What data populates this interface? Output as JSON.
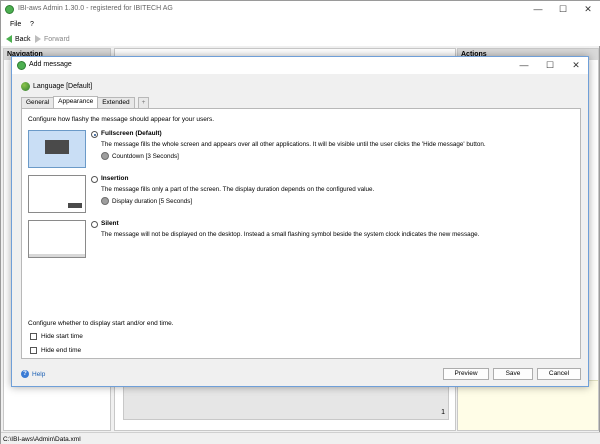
{
  "main": {
    "title": "IBI-aws Admin 1.30.0 - registered for IBITECH AG",
    "menu": [
      "File",
      "?"
    ],
    "back": "Back",
    "forward": "Forward",
    "nav_header": "Navigation",
    "actions_header": "Actions",
    "page_number": "1",
    "status_path": "C:\\IBI-aws\\Admin\\Data.xml"
  },
  "dialog": {
    "title": "Add message",
    "language": "Language [Default]",
    "tabs": [
      "General",
      "Appearance",
      "Extended",
      "+"
    ],
    "intro": "Configure how flashy the message should appear for your users.",
    "modes": [
      {
        "title": "Fullscreen (Default)",
        "desc": "The message fills the whole screen and appears over all other applications. It will be visible until the user clicks  the 'Hide message' button.",
        "option": "Countdown [3 Seconds]",
        "selected": true
      },
      {
        "title": "Insertion",
        "desc": "The message fills only a part of the screen. The display duration depends on the configured value.",
        "option": "Display duration [5 Seconds]",
        "selected": false
      },
      {
        "title": "Silent",
        "desc": "The message will not be displayed on the desktop. Instead a small flashing symbol beside the system clock indicates the new message.",
        "option": "",
        "selected": false
      }
    ],
    "time_config": "Configure whether to display start and/or end time.",
    "hide_start": "Hide start time",
    "hide_end": "Hide end time",
    "help": "Help",
    "preview_btn": "Preview",
    "save_btn": "Save",
    "cancel_btn": "Cancel"
  }
}
